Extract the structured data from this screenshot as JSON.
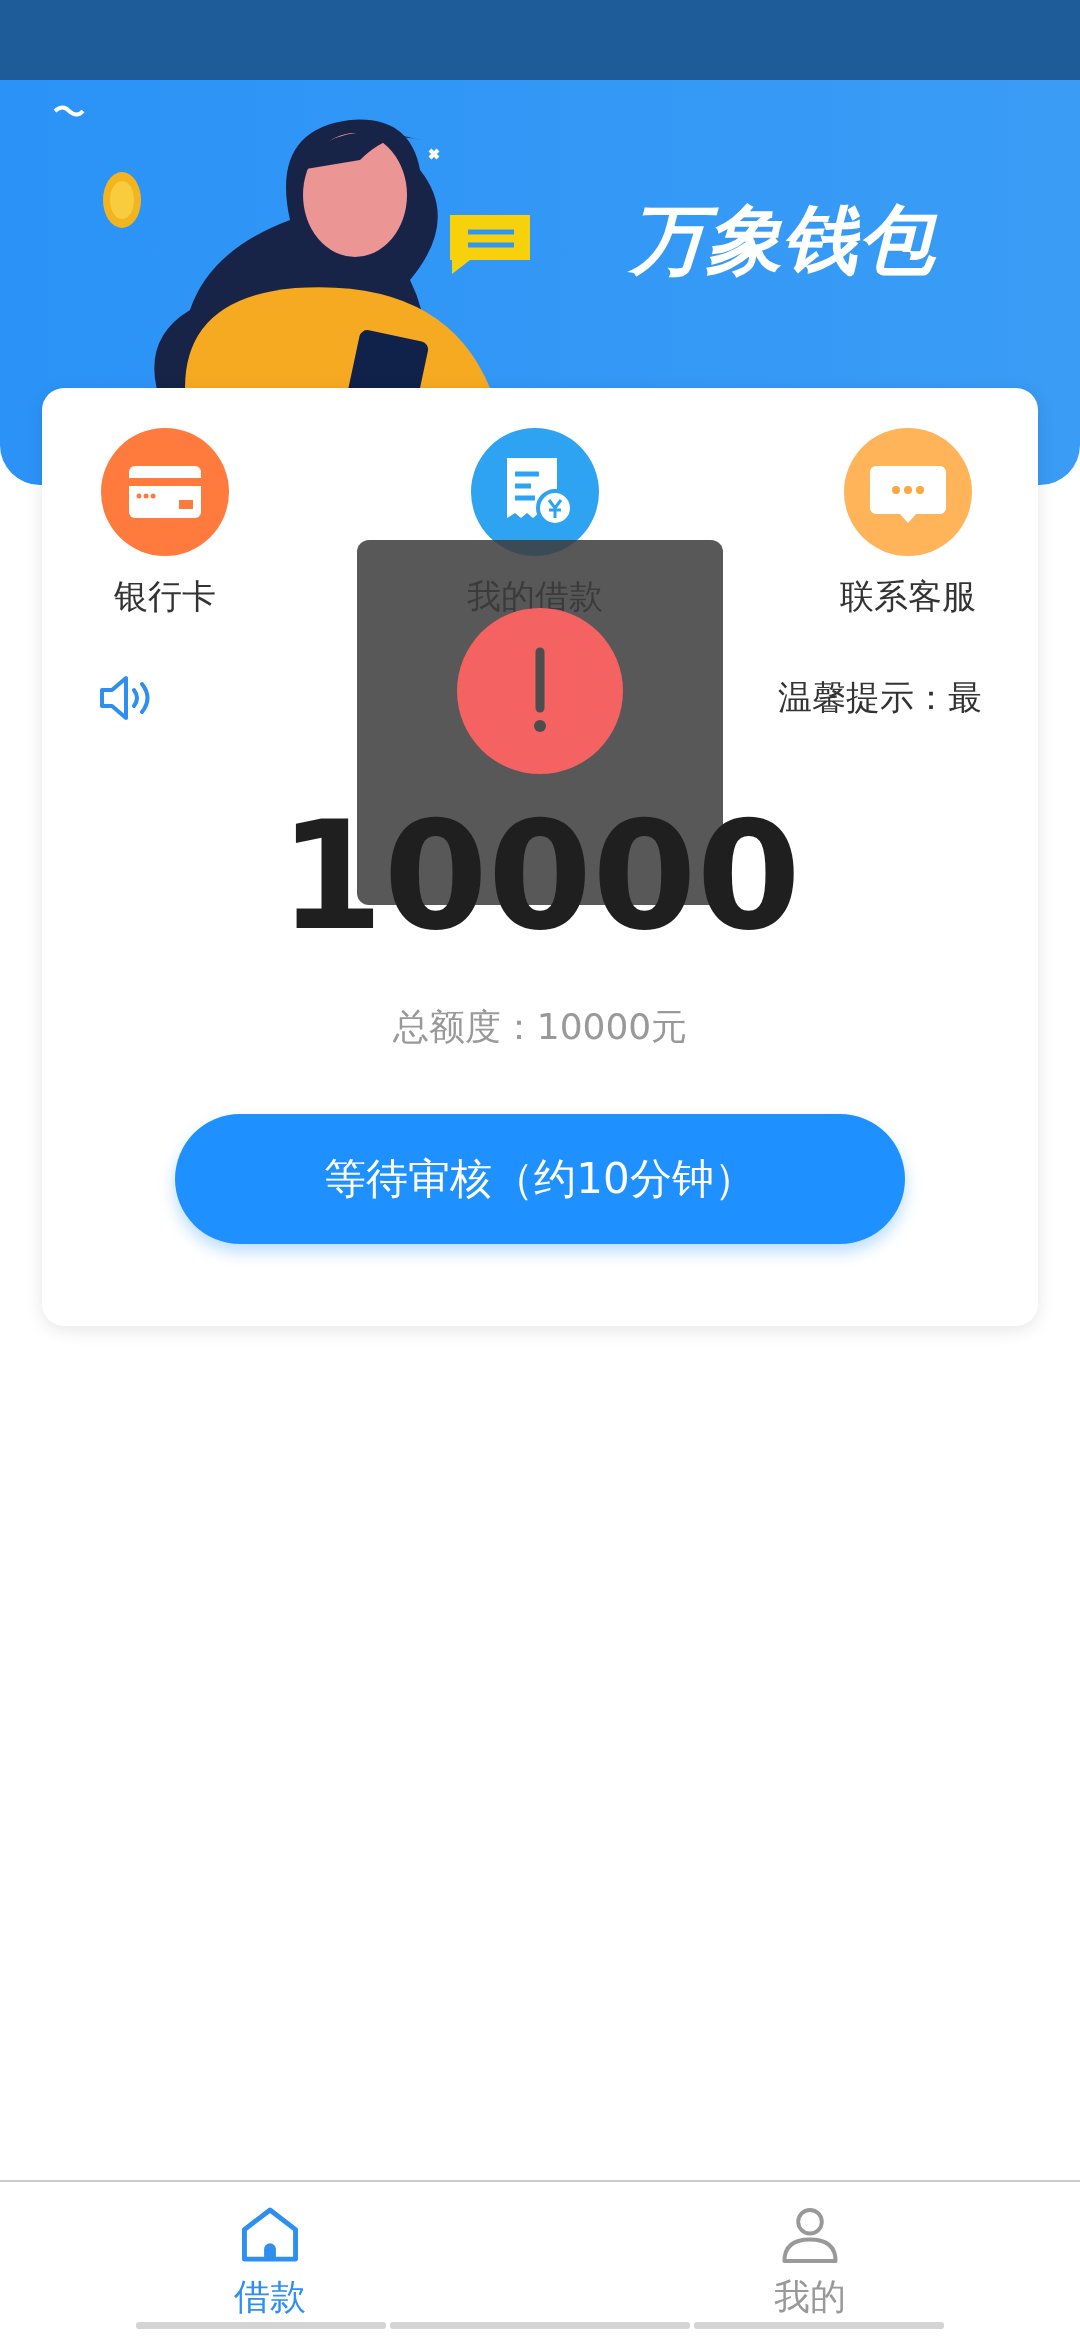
{
  "banner": {
    "title": "万象钱包"
  },
  "shortcuts": [
    {
      "label": "银行卡",
      "kind": "card"
    },
    {
      "label": "我的借款",
      "kind": "bill"
    },
    {
      "label": "联系客服",
      "kind": "chat"
    }
  ],
  "notice": {
    "text": "温馨提示：最"
  },
  "amount": "10000",
  "total": "总额度：10000元",
  "action_button": {
    "label": "等待审核（约10分钟）"
  },
  "toast": {
    "kind": "error"
  },
  "tabs": [
    {
      "label": "借款",
      "kind": "home",
      "selected": true
    },
    {
      "label": "我的",
      "kind": "person",
      "selected": false
    }
  ]
}
